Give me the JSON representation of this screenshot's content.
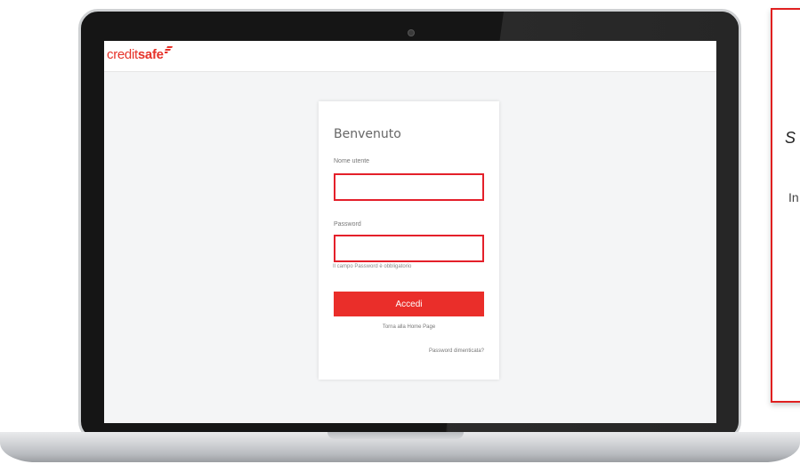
{
  "brand": {
    "logo_light": "credit",
    "logo_bold": "safe",
    "color": "#e6332a"
  },
  "login": {
    "title": "Benvenuto",
    "username_label": "Nome utente",
    "username_value": "",
    "password_label": "Password",
    "password_value": "",
    "password_error": "Il campo Password è obbligatorio",
    "submit_label": "Accedi",
    "home_link": "Torna alla Home Page",
    "forgot_link": "Password dimenticata?",
    "error_color": "#e4202a",
    "button_color": "#ea2e2a"
  },
  "callout": {
    "heading": "S",
    "text": "In"
  }
}
